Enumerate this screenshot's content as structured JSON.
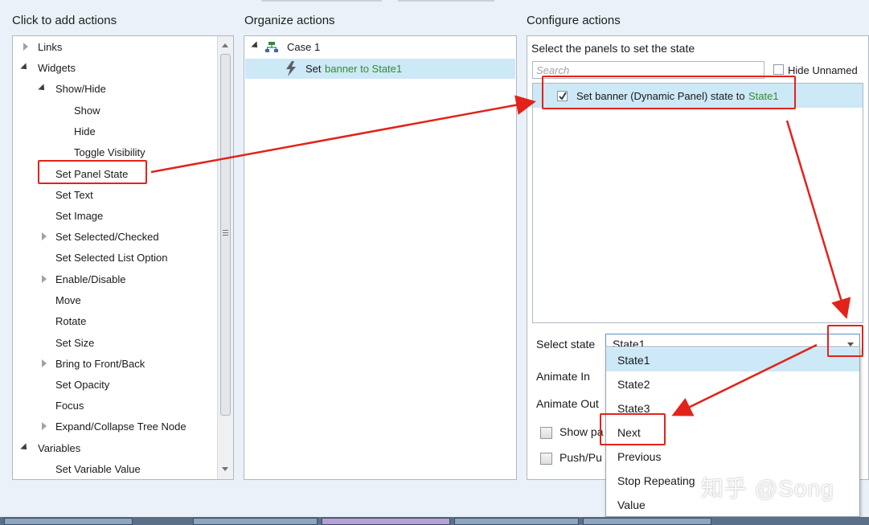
{
  "columns": {
    "add_actions": "Click to add actions",
    "organize_actions": "Organize actions",
    "configure_actions": "Configure actions"
  },
  "add_tree": [
    "Links",
    "Widgets",
    "Show/Hide",
    "Show",
    "Hide",
    "Toggle Visibility",
    "Set Panel State",
    "Set Text",
    "Set Image",
    "Set Selected/Checked",
    "Set Selected List Option",
    "Enable/Disable",
    "Move",
    "Rotate",
    "Set Size",
    "Bring to Front/Back",
    "Set Opacity",
    "Focus",
    "Expand/Collapse Tree Node",
    "Variables",
    "Set Variable Value"
  ],
  "organize": {
    "case_label": "Case 1",
    "action_prefix": "Set",
    "action_target": "banner to State1"
  },
  "configure": {
    "panels_title": "Select the panels to set the state",
    "search_placeholder": "Search",
    "hide_unnamed": "Hide Unnamed",
    "panel_row_text": "Set banner (Dynamic Panel) state to",
    "panel_row_state": "State1",
    "select_state_label": "Select state",
    "select_state_value": "State1",
    "animate_in_label": "Animate In",
    "animate_out_label": "Animate Out",
    "show_panel_label": "Show pa",
    "push_pull_label": "Push/Pu",
    "dropdown_options": [
      "State1",
      "State2",
      "State3",
      "Next",
      "Previous",
      "Stop Repeating",
      "Value"
    ]
  },
  "watermark": "知乎 @Song",
  "colors": {
    "annotation_red": "#e2231a",
    "selection_blue": "#cde8f6",
    "state_green": "#2f8f2f"
  }
}
